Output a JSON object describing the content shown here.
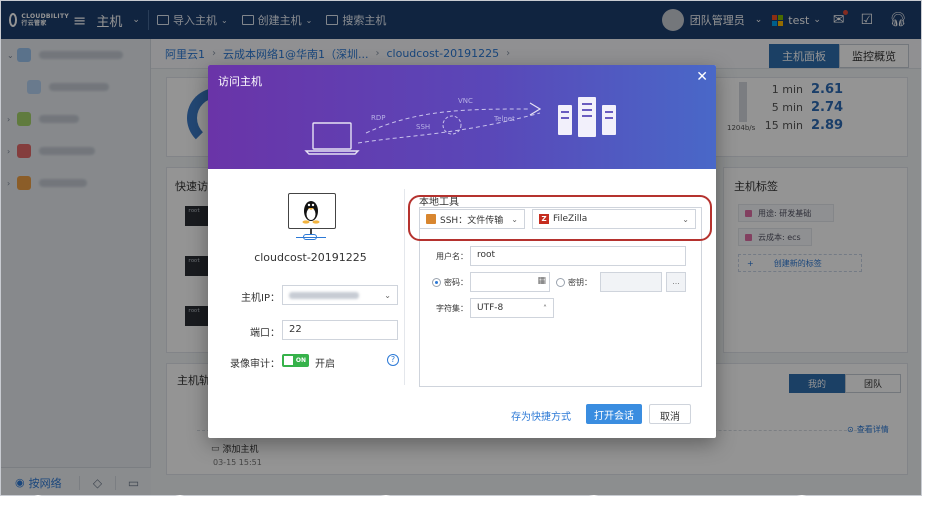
{
  "topbar": {
    "logo_line1": "CLOUDBILITY",
    "logo_line2": "行云管家",
    "module": "主机",
    "actions": [
      {
        "label": "导入主机",
        "icon": "import-host-icon"
      },
      {
        "label": "创建主机",
        "icon": "create-host-icon"
      },
      {
        "label": "搜索主机",
        "icon": "search-host-icon"
      }
    ],
    "team": "团队管理员",
    "workspace": "test"
  },
  "breadcrumb": [
    "阿里云1",
    "云成本网络1@华南1（深圳...",
    "cloudcost-20191225"
  ],
  "view_tabs": {
    "active": "主机面板",
    "inactive": "监控概览"
  },
  "sidebar_bottom": {
    "network_label": "按网络"
  },
  "background": {
    "quick_access_title": "快速访",
    "load": [
      {
        "label": "1 min",
        "value": "2.61"
      },
      {
        "label": "5 min",
        "value": "2.74"
      },
      {
        "label": "15 min",
        "value": "2.89"
      }
    ],
    "bandwidth": "1204b/s",
    "tags_title": "主机标签",
    "tags": [
      "用途: 研发基础",
      "云成本: ecs"
    ],
    "add_tag": "创建新的标签",
    "track_title": "主机轨",
    "track_tabs": [
      "我的",
      "团队"
    ],
    "track_event": "添加主机",
    "track_time": "03-15 15:51",
    "view_detail": "查看详情",
    "terminal_text": "root"
  },
  "dialog": {
    "title": "访问主机",
    "illustration_labels": [
      "RDP",
      "SSH",
      "VNC",
      "Telnet"
    ],
    "host_name": "cloudcost-20191225",
    "host_ip_label": "主机IP：",
    "port_label": "端口：",
    "port_value": "22",
    "record_label": "录像审计：",
    "record_toggle": "ON",
    "record_state": "开启",
    "local_tool_title": "本地工具",
    "protocol_select": "SSH：文件传输",
    "tool_select": "FileZilla",
    "username_label": "用户名：",
    "username_value": "root",
    "password_label": "密码：",
    "key_label": "密钥：",
    "key_button": "...",
    "charset_label": "字符集：",
    "charset_value": "UTF-8",
    "save_shortcut": "存为快捷方式",
    "open_session": "打开会话",
    "cancel": "取消"
  },
  "colors": {
    "topbar": "#1d3e6e",
    "accent": "#2c79d6",
    "dialog_gradient_start": "#6a34a8",
    "dialog_gradient_end": "#4968c8",
    "highlight": "#b5322e",
    "toggle_on": "#36b24a"
  }
}
